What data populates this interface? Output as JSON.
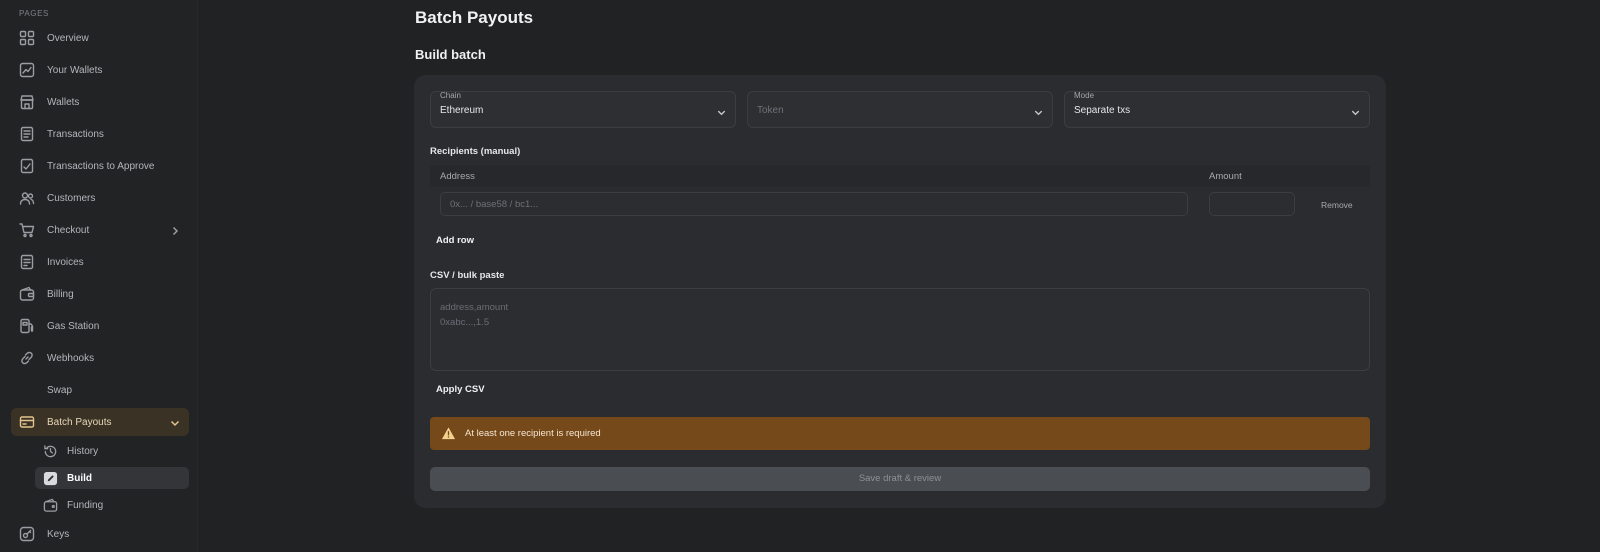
{
  "sidebar": {
    "section_label": "PAGES",
    "items": [
      {
        "label": "Overview"
      },
      {
        "label": "Your Wallets"
      },
      {
        "label": "Wallets"
      },
      {
        "label": "Transactions"
      },
      {
        "label": "Transactions to Approve"
      },
      {
        "label": "Customers"
      },
      {
        "label": "Checkout"
      },
      {
        "label": "Invoices"
      },
      {
        "label": "Billing"
      },
      {
        "label": "Gas Station"
      },
      {
        "label": "Webhooks"
      },
      {
        "label": "Swap"
      },
      {
        "label": "Batch Payouts"
      },
      {
        "label": "Keys"
      }
    ],
    "batch_sub": [
      {
        "label": "History"
      },
      {
        "label": "Build"
      },
      {
        "label": "Funding"
      }
    ]
  },
  "page": {
    "title": "Batch Payouts",
    "section_title": "Build batch"
  },
  "form": {
    "chain": {
      "label": "Chain",
      "value": "Ethereum"
    },
    "token": {
      "placeholder": "Token"
    },
    "mode": {
      "label": "Mode",
      "value": "Separate txs"
    },
    "recipients_heading": "Recipients (manual)",
    "col_address": "Address",
    "col_amount": "Amount",
    "address_placeholder": "0x... / base58 / bc1...",
    "amount_value": "",
    "remove_label": "Remove",
    "add_row_label": "Add row",
    "csv_heading": "CSV / bulk paste",
    "csv_placeholder_line1": "address,amount",
    "csv_placeholder_line2": "0xabc...,1.5",
    "apply_csv_label": "Apply CSV",
    "alert_message": "At least one recipient is required",
    "submit_label": "Save draft & review"
  },
  "colors": {
    "accent": "#e2c48c",
    "alert_bg": "#76491a",
    "active_nav_bg": "#3b3226"
  }
}
